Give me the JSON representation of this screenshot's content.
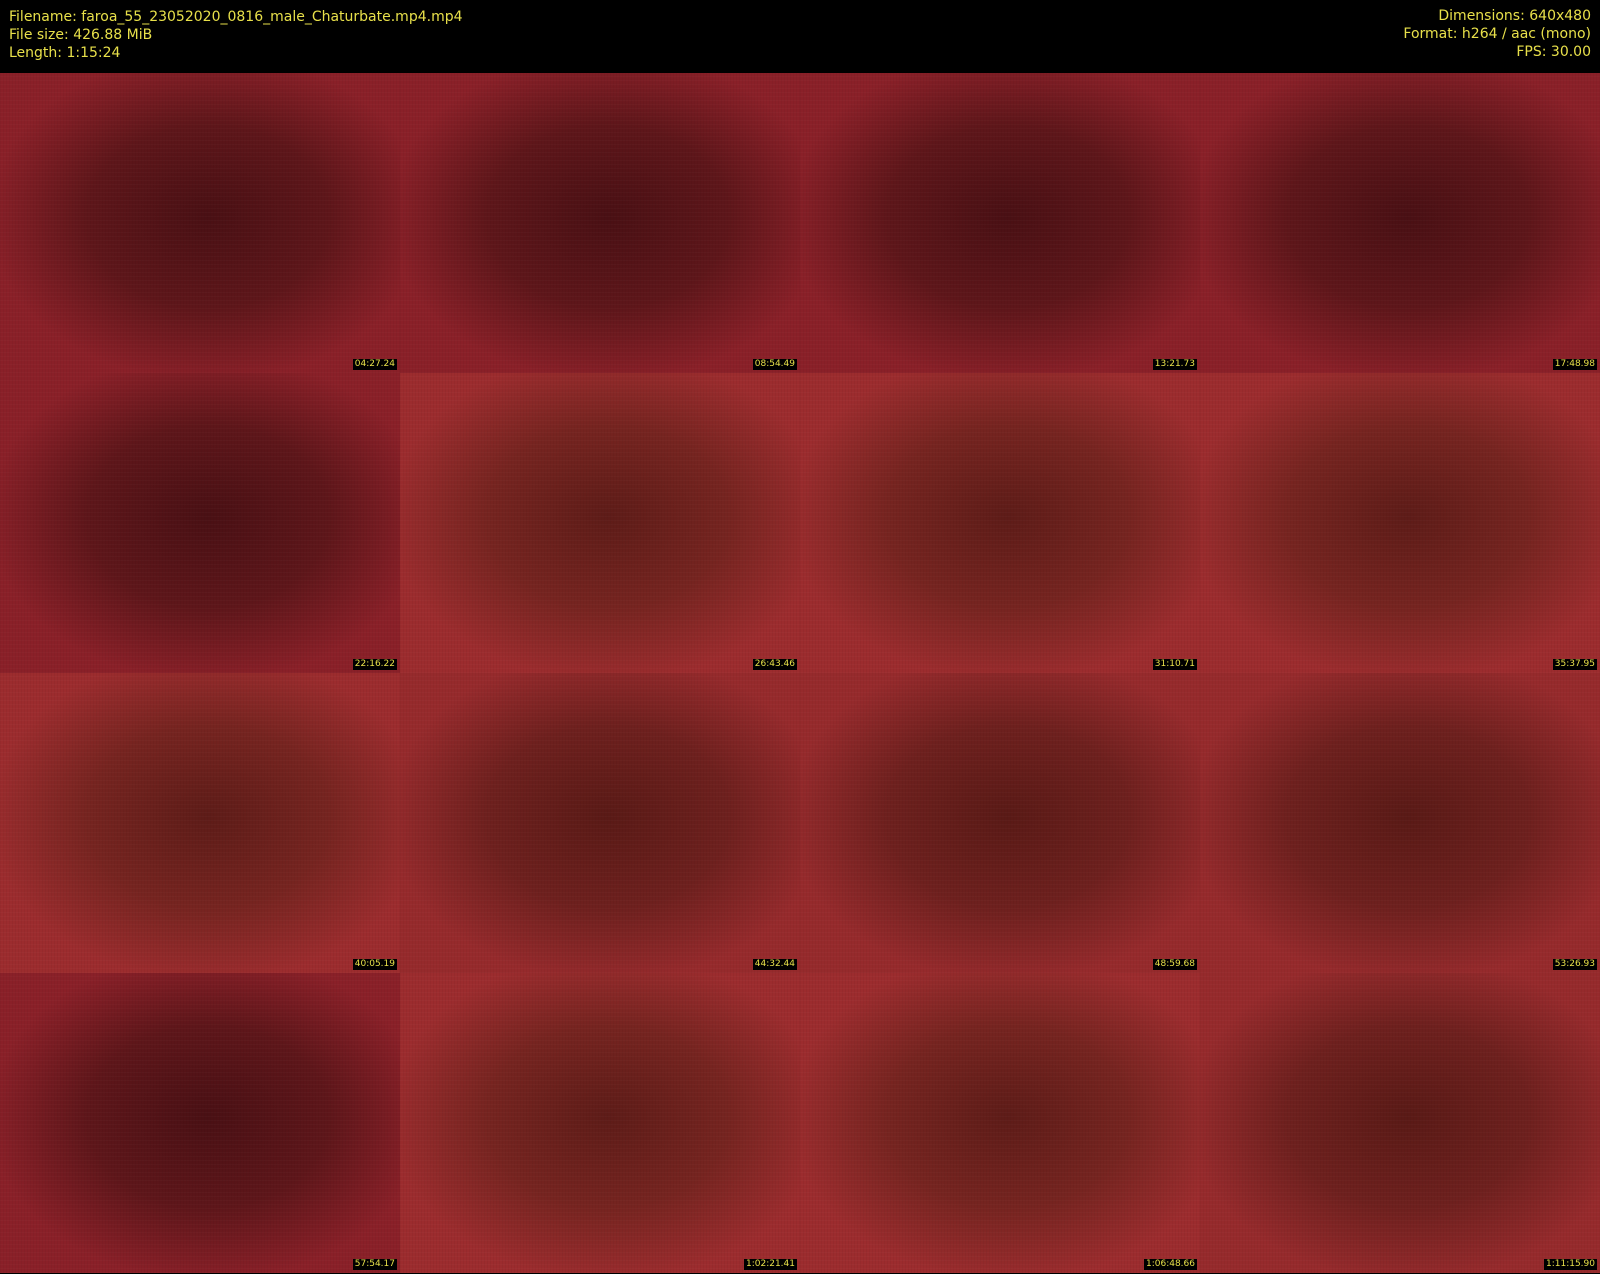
{
  "header": {
    "filename": "Filename: faroa_55_23052020_0816_male_Chaturbate.mp4.mp4",
    "filesize": "File size: 426.88 MiB",
    "length": "Length: 1:15:24",
    "dimensions": "Dimensions: 640x480",
    "format": "Format: h264 / aac (mono)",
    "fps": "FPS: 30.00"
  },
  "colors": {
    "background": "#000000",
    "text": "#e8e04a"
  },
  "thumbnails": [
    {
      "timestamp": "04:27.24",
      "tone": "dark"
    },
    {
      "timestamp": "08:54.49",
      "tone": "dark"
    },
    {
      "timestamp": "13:21.73",
      "tone": "dark"
    },
    {
      "timestamp": "17:48.98",
      "tone": "dark"
    },
    {
      "timestamp": "22:16.22",
      "tone": "dark"
    },
    {
      "timestamp": "26:43.46",
      "tone": "light"
    },
    {
      "timestamp": "31:10.71",
      "tone": "light"
    },
    {
      "timestamp": "35:37.95",
      "tone": "light"
    },
    {
      "timestamp": "40:05.19",
      "tone": "light"
    },
    {
      "timestamp": "44:32.44",
      "tone": "mid"
    },
    {
      "timestamp": "48:59.68",
      "tone": "mid"
    },
    {
      "timestamp": "53:26.93",
      "tone": "mid"
    },
    {
      "timestamp": "57:54.17",
      "tone": "dark"
    },
    {
      "timestamp": "1:02:21.41",
      "tone": "light"
    },
    {
      "timestamp": "1:06:48.66",
      "tone": "light"
    },
    {
      "timestamp": "1:11:15.90",
      "tone": "mid"
    }
  ]
}
